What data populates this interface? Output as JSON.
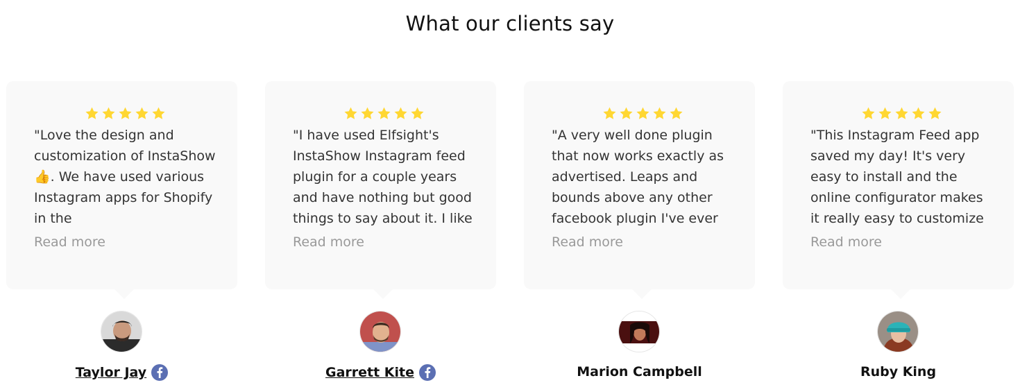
{
  "section": {
    "title": "What our clients say"
  },
  "colors": {
    "star": "#FFD732",
    "card_bg": "#f9f9f9",
    "facebook": "#5b6fb3",
    "read_more": "#999999"
  },
  "testimonials": [
    {
      "rating": 5,
      "quote": "\"Love the design and customization of InstaShow 👍. We have used various Instagram apps for Shopify in the",
      "read_more": "Read more",
      "author": "Taylor Jay",
      "author_link": true,
      "source_icon": "facebook-icon"
    },
    {
      "rating": 5,
      "quote": "\"I have used Elfsight's InstaShow Instagram feed plugin for a couple years and have nothing but good things to say about it. I like",
      "read_more": "Read more",
      "author": "Garrett Kite",
      "author_link": true,
      "source_icon": "facebook-icon"
    },
    {
      "rating": 5,
      "quote": "\"A very well done plugin that now works exactly as advertised. Leaps and bounds above any other facebook plugin I've ever",
      "read_more": "Read more",
      "author": "Marion Campbell",
      "author_link": false,
      "source_icon": ""
    },
    {
      "rating": 5,
      "quote": "\"This Instagram Feed app saved my day! It's very easy to install and the online configurator makes it really easy to customize",
      "read_more": "Read more",
      "author": "Ruby King",
      "author_link": false,
      "source_icon": ""
    }
  ]
}
